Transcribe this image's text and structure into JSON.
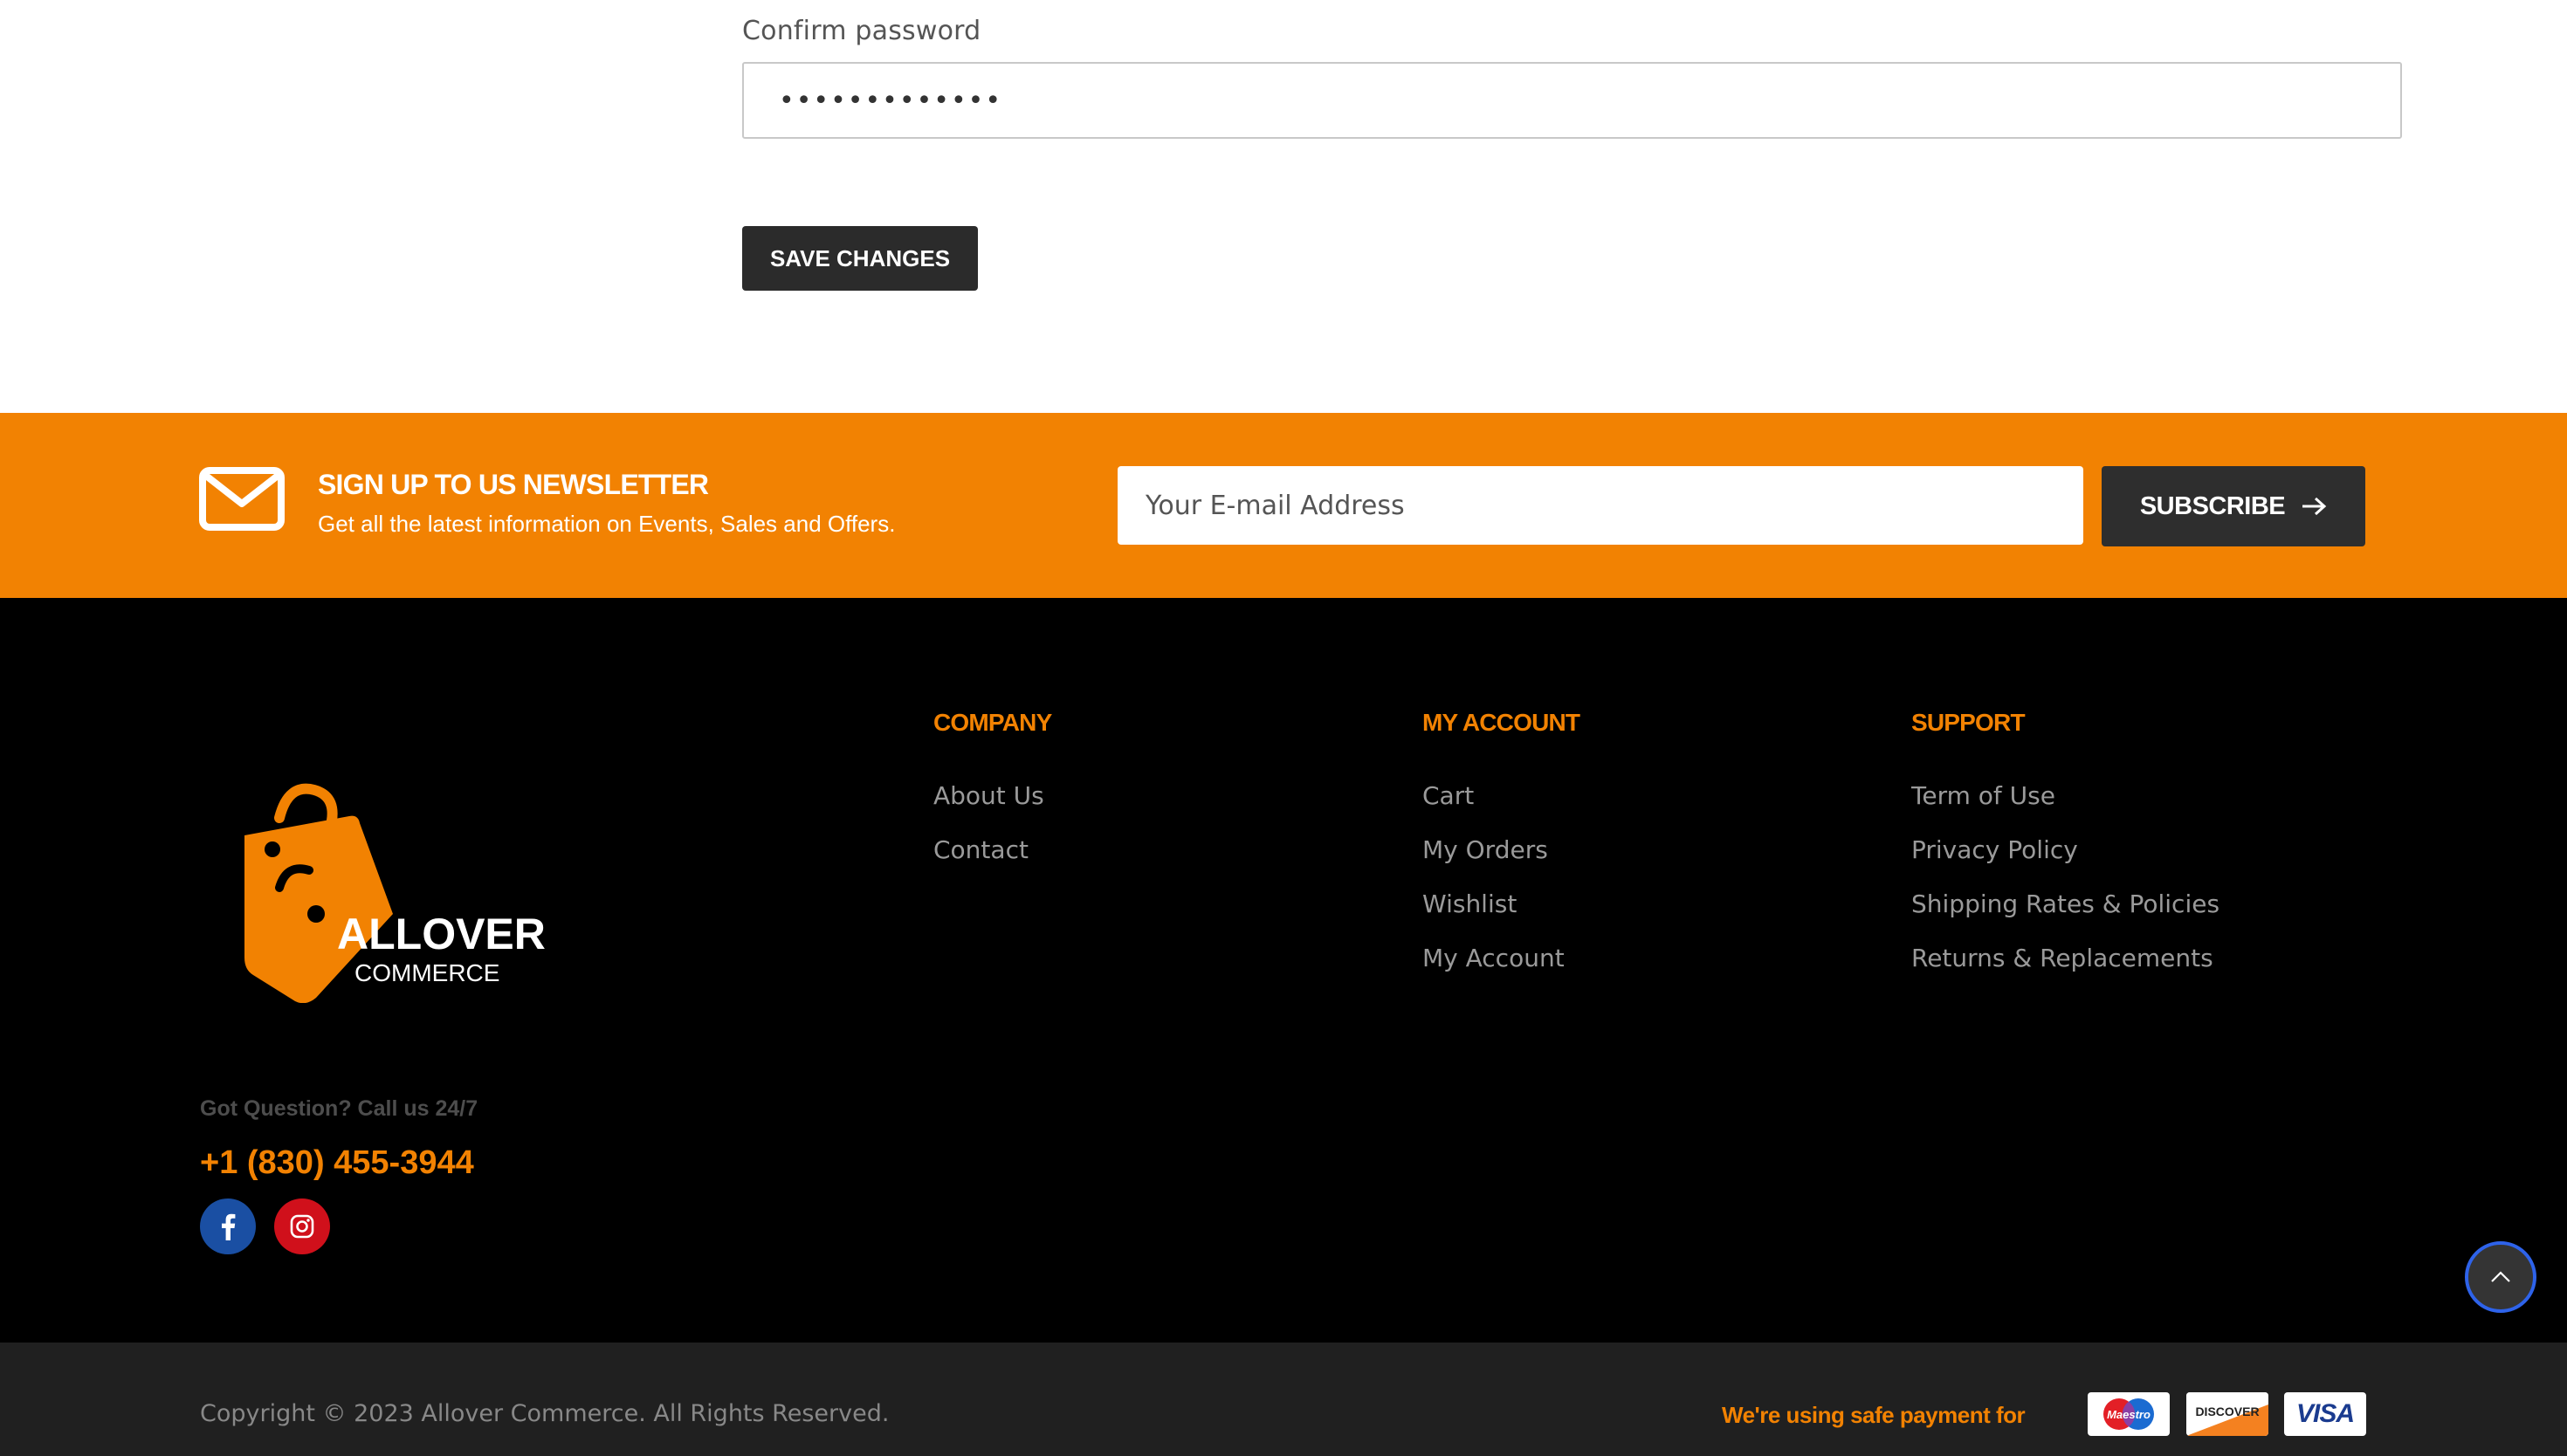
{
  "form": {
    "confirm_label": "Confirm password",
    "confirm_value": "•••••••••••••",
    "save_label": "SAVE CHANGES"
  },
  "newsletter": {
    "icon": "envelope-icon",
    "title": "SIGN UP TO US NEWSLETTER",
    "subtitle": "Get all the latest information on Events, Sales and Offers.",
    "email_placeholder": "Your E-mail Address",
    "subscribe_label": "SUBSCRIBE",
    "accent_color": "#f28202"
  },
  "footer": {
    "logo": {
      "line1": "ALLOVER",
      "line2": "COMMERCE"
    },
    "question": "Got Question? Call us 24/7",
    "phone": "+1 (830) 455-3944",
    "social": [
      "facebook-icon",
      "instagram-icon"
    ],
    "columns": [
      {
        "heading": "COMPANY",
        "links": [
          "About Us",
          "Contact"
        ]
      },
      {
        "heading": "MY ACCOUNT",
        "links": [
          "Cart",
          "My Orders",
          "Wishlist",
          "My Account"
        ]
      },
      {
        "heading": "SUPPORT",
        "links": [
          "Term of Use",
          "Privacy Policy",
          "Shipping Rates & Policies",
          "Returns & Replacements"
        ]
      }
    ]
  },
  "bottom": {
    "copyright": "Copyright © 2023 Allover Commerce. All Rights Reserved.",
    "payment_text": "We're using safe payment for",
    "cards": [
      "Maestro",
      "DISCOVER",
      "VISA"
    ]
  }
}
